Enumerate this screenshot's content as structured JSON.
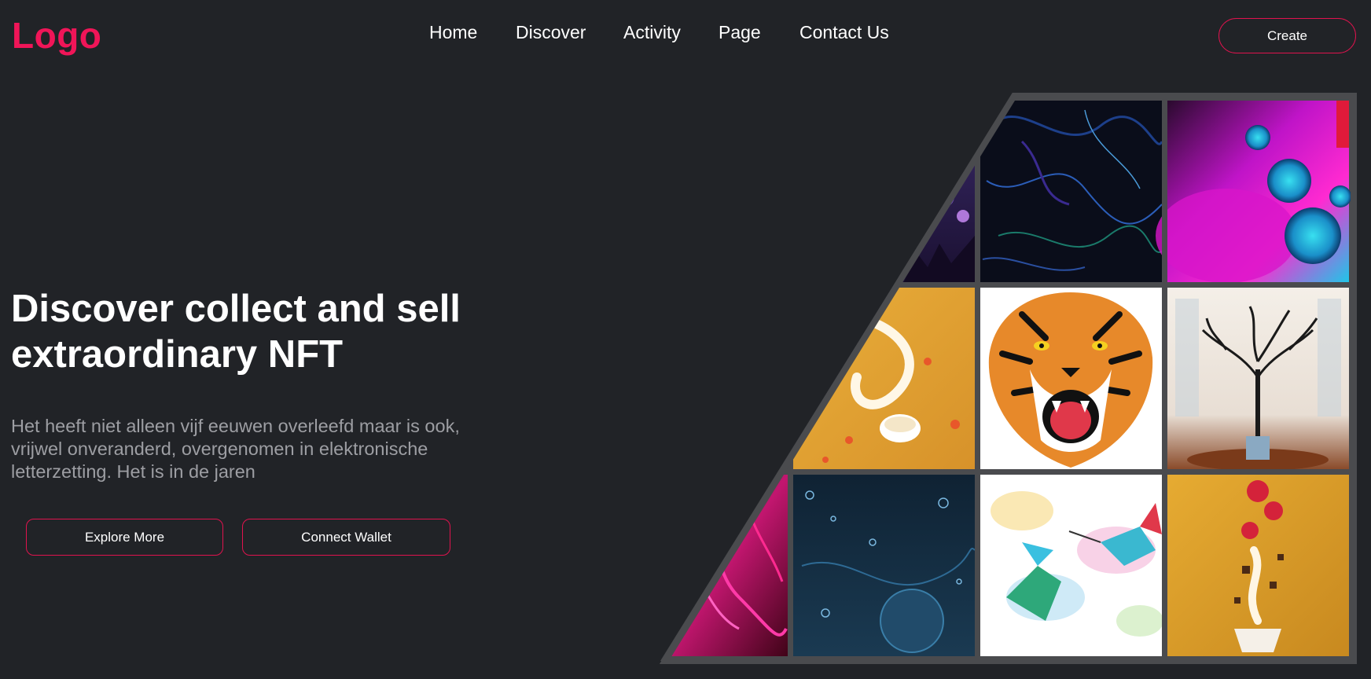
{
  "header": {
    "logo": "Logo",
    "nav": [
      "Home",
      "Discover",
      "Activity",
      "Page",
      "Contact Us"
    ],
    "create_label": "Create"
  },
  "hero": {
    "title": "Discover collect and sell extraordinary NFT",
    "description": "Het heeft niet alleen vijf eeuwen overleefd maar is ook, vrijwel onveranderd, overgenomen in elektronische letterzetting. Het is in de jaren",
    "explore_label": "Explore More",
    "connect_label": "Connect Wallet"
  },
  "colors": {
    "background": "#212327",
    "accent": "#f01558",
    "frame": "#4a4b4e"
  },
  "gallery": {
    "tiles": [
      {
        "name": "concert-crowd-image"
      },
      {
        "name": "dark-marble-swirl-image"
      },
      {
        "name": "neon-bubbles-image"
      },
      {
        "name": "cream-splash-image"
      },
      {
        "name": "tiger-head-image"
      },
      {
        "name": "ink-tree-room-image"
      },
      {
        "name": "pink-fluid-image"
      },
      {
        "name": "blue-oil-bubbles-image"
      },
      {
        "name": "hummingbirds-watercolor-image"
      },
      {
        "name": "strawberry-dessert-image"
      }
    ]
  }
}
